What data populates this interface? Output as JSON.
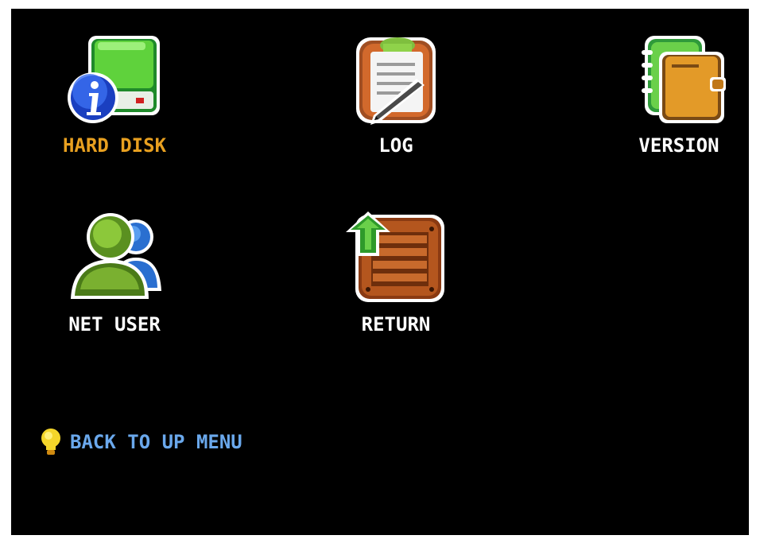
{
  "menu": {
    "items": [
      {
        "label": "HARD DISK",
        "icon": "hard-disk-info-icon",
        "selected": true
      },
      {
        "label": "LOG",
        "icon": "clipboard-log-icon",
        "selected": false
      },
      {
        "label": "VERSION",
        "icon": "notebook-version-icon",
        "selected": false
      },
      {
        "label": "NET USER",
        "icon": "users-icon",
        "selected": false
      },
      {
        "label": "RETURN",
        "icon": "return-crate-arrow-icon",
        "selected": false
      }
    ]
  },
  "hint": {
    "text": "BACK TO UP MENU",
    "icon": "lightbulb-icon"
  },
  "colors": {
    "background": "#000000",
    "label": "#ffffff",
    "selected_label": "#e8a020",
    "hint_text": "#6aa8ec"
  }
}
